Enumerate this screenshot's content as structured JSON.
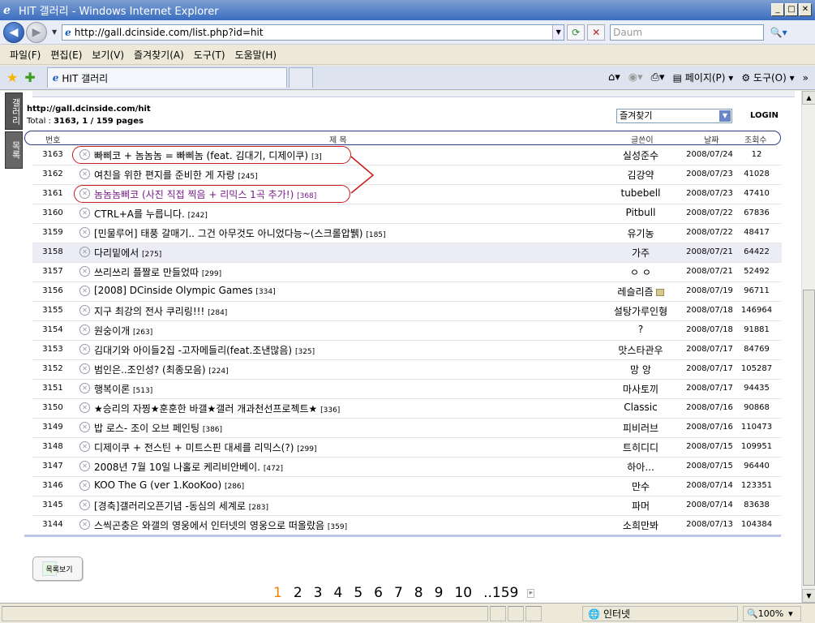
{
  "window": {
    "title": "HIT 갤러리 - Windows Internet Explorer",
    "address": "http://gall.dcinside.com/list.php?id=hit",
    "search_placeholder": "Daum",
    "tab_title": "HIT 갤러리"
  },
  "menu": [
    "파일(F)",
    "편집(E)",
    "보기(V)",
    "즐겨찾기(A)",
    "도구(T)",
    "도움말(H)"
  ],
  "command_bar": {
    "page_label": "페이지(P)",
    "tools_label": "도구(O)"
  },
  "side_tabs": {
    "gallery": "갤러리",
    "list": "목록"
  },
  "header": {
    "url": "http://gall.dcinside.com/hit",
    "total_prefix": "Total : ",
    "total_value": "3163, 1 / 159 pages",
    "favorites": "즐겨찾기",
    "login": "LOGIN"
  },
  "columns": {
    "num": "번호",
    "title": "제 목",
    "author": "글쓴이",
    "date": "날짜",
    "views": "조회수"
  },
  "rows": [
    {
      "num": "3163",
      "title": "빠삐코 + 놈놈놈 = 빠삐놈 (feat. 김대기, 디제이쿠)",
      "comments": "[3]",
      "author": "실성준수",
      "date": "2008/07/24",
      "views": "12"
    },
    {
      "num": "3162",
      "title": "여친을 위한 편지를 준비한 게 자랑",
      "comments": "[245]",
      "author": "김강약",
      "date": "2008/07/23",
      "views": "41028"
    },
    {
      "num": "3161",
      "title": "놈놈놈삐코 (사진 직접 찍음 + 리믹스 1곡 추가!)",
      "comments": "[368]",
      "author": "tubebell",
      "date": "2008/07/23",
      "views": "47410"
    },
    {
      "num": "3160",
      "title": "CTRL+A를 누릅니다.",
      "comments": "[242]",
      "author": "Pitbull",
      "date": "2008/07/22",
      "views": "67836"
    },
    {
      "num": "3159",
      "title": "[민물루어] 태풍 갈매기.. 그건 아무것도 아니었다능~(스크롤압뷁)",
      "comments": "[185]",
      "author": "유기농",
      "date": "2008/07/22",
      "views": "48417"
    },
    {
      "num": "3158",
      "title": "다리밑에서",
      "comments": "[275]",
      "author": "가주",
      "date": "2008/07/21",
      "views": "64422"
    },
    {
      "num": "3157",
      "title": "쓰리쓰리 플짤로 만들었따",
      "comments": "[299]",
      "author": "ㅇ ㅇ",
      "date": "2008/07/21",
      "views": "52492"
    },
    {
      "num": "3156",
      "title": "[2008] DCinside Olympic Games",
      "comments": "[334]",
      "author": "레슬리즘",
      "date": "2008/07/19",
      "views": "96711"
    },
    {
      "num": "3155",
      "title": "지구 최강의 전사 쿠리링!!!",
      "comments": "[284]",
      "author": "설탕가루인형",
      "date": "2008/07/18",
      "views": "146964"
    },
    {
      "num": "3154",
      "title": "원숭이개",
      "comments": "[263]",
      "author": "?",
      "date": "2008/07/18",
      "views": "91881"
    },
    {
      "num": "3153",
      "title": "김대기와 아이들2집 -고자메들리(feat.조낸많음)",
      "comments": "[325]",
      "author": "맛스타관우",
      "date": "2008/07/17",
      "views": "84769"
    },
    {
      "num": "3152",
      "title": "범인은..조인성? (최종모음)",
      "comments": "[224]",
      "author": "망 앙",
      "date": "2008/07/17",
      "views": "105287"
    },
    {
      "num": "3151",
      "title": "행복이론",
      "comments": "[513]",
      "author": "마사토끼",
      "date": "2008/07/17",
      "views": "94435"
    },
    {
      "num": "3150",
      "title": "★승리의 자찡★훈훈한 바갤★갤러 개과천선프로젝트★",
      "comments": "[336]",
      "author": "Classic",
      "date": "2008/07/16",
      "views": "90868"
    },
    {
      "num": "3149",
      "title": "밥 로스- 조이 오브 페인팅",
      "comments": "[386]",
      "author": "피비러브",
      "date": "2008/07/16",
      "views": "110473"
    },
    {
      "num": "3148",
      "title": "디제이쿠 + 전스틴 + 미트스핀 대세를 리믹스(?)",
      "comments": "[299]",
      "author": "트히디디",
      "date": "2008/07/15",
      "views": "109951"
    },
    {
      "num": "3147",
      "title": "2008년 7월 10일 나홀로 케리비안베이.",
      "comments": "[472]",
      "author": "하아...",
      "date": "2008/07/15",
      "views": "96440"
    },
    {
      "num": "3146",
      "title": "KOO The G (ver 1.KooKoo)",
      "comments": "[286]",
      "author": "만수",
      "date": "2008/07/14",
      "views": "123351"
    },
    {
      "num": "3145",
      "title": "[경축]갤러리오픈기념 -동심의 세계로",
      "comments": "[283]",
      "author": "파머",
      "date": "2008/07/14",
      "views": "83638"
    },
    {
      "num": "3144",
      "title": "스씩곤충은 와갤의 영웅에서 인터넷의 영웅으로 떠올랐음",
      "comments": "[359]",
      "author": "소희만봐",
      "date": "2008/07/13",
      "views": "104384"
    }
  ],
  "list_button": "목록보기",
  "pagination": [
    "1",
    "2",
    "3",
    "4",
    "5",
    "6",
    "7",
    "8",
    "9",
    "10",
    "..159"
  ],
  "status": {
    "zone": "인터넷",
    "zoom": "100%"
  },
  "colors": {
    "highlight_oval": "#c81a1a",
    "current_page": "#f08200",
    "title_highlight": "#7a1a8a"
  }
}
